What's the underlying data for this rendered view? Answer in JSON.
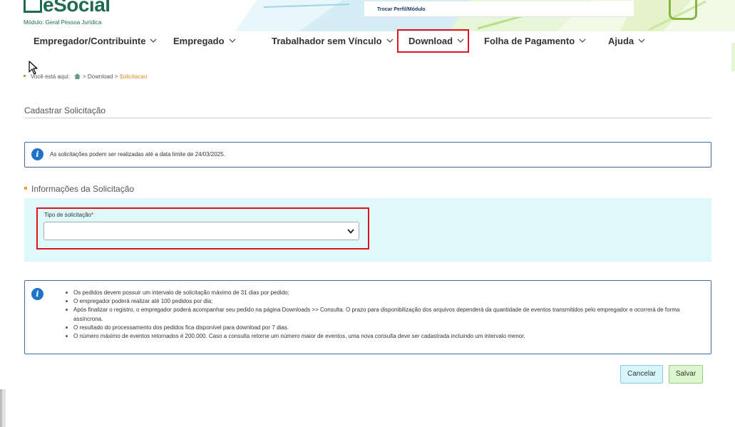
{
  "header": {
    "logo_text": "eSocial",
    "module_label": "Módulo: Geral Pessoa Jurídica",
    "perfil_link": "Trocar Perfil/Módulo"
  },
  "nav": {
    "items": [
      {
        "label": "Empregador/Contribuinte"
      },
      {
        "label": "Empregado"
      },
      {
        "label": "Trabalhador sem Vínculo"
      },
      {
        "label": "Download"
      },
      {
        "label": "Folha de Pagamento"
      },
      {
        "label": "Ajuda"
      }
    ]
  },
  "breadcrumb": {
    "prefix": "Você está aqui:",
    "items": [
      "Download",
      "Solicitacao"
    ],
    "separator": ">"
  },
  "page": {
    "title": "Cadastrar Solicitação"
  },
  "alert": {
    "text": "As solicitações podem ser realizadas até a data limite de 24/03/2025."
  },
  "section": {
    "title": "Informações da Solicitação",
    "field_label": "Tipo de solicitação",
    "required_mark": "*",
    "selected_value": ""
  },
  "info": {
    "items": [
      "Os pedidos devem possuir um intervalo de solicitação máximo de 31 dias por pedido;",
      "O empregador poderá realizar até 100 pedidos por dia;",
      "Após finalizar o registro, o empregador poderá acompanhar seu pedido na página Downloads >> Consulta. O prazo para disponibilização dos arquivos dependerá da quantidade de eventos transmitidos pelo empregador e ocorrerá de forma assíncrona.",
      "O resultado do processamento dos pedidos fica disponível para download por 7 dias.",
      "O número máximo de eventos retornados é 200.000. Caso a consulta retorne um número maior de eventos, uma nova consulta deve ser cadastrada incluindo um intervalo menor."
    ]
  },
  "buttons": {
    "cancel": "Cancelar",
    "save": "Salvar"
  },
  "colors": {
    "brand_green": "#1e6b4f",
    "accent_orange": "#e28a1f",
    "highlight_red": "#e0141c",
    "panel_cyan": "#dff8fa",
    "info_blue": "#1f73c8"
  },
  "icons": [
    "info-icon",
    "home-icon",
    "chevron-down-icon",
    "mouse-cursor-icon"
  ]
}
